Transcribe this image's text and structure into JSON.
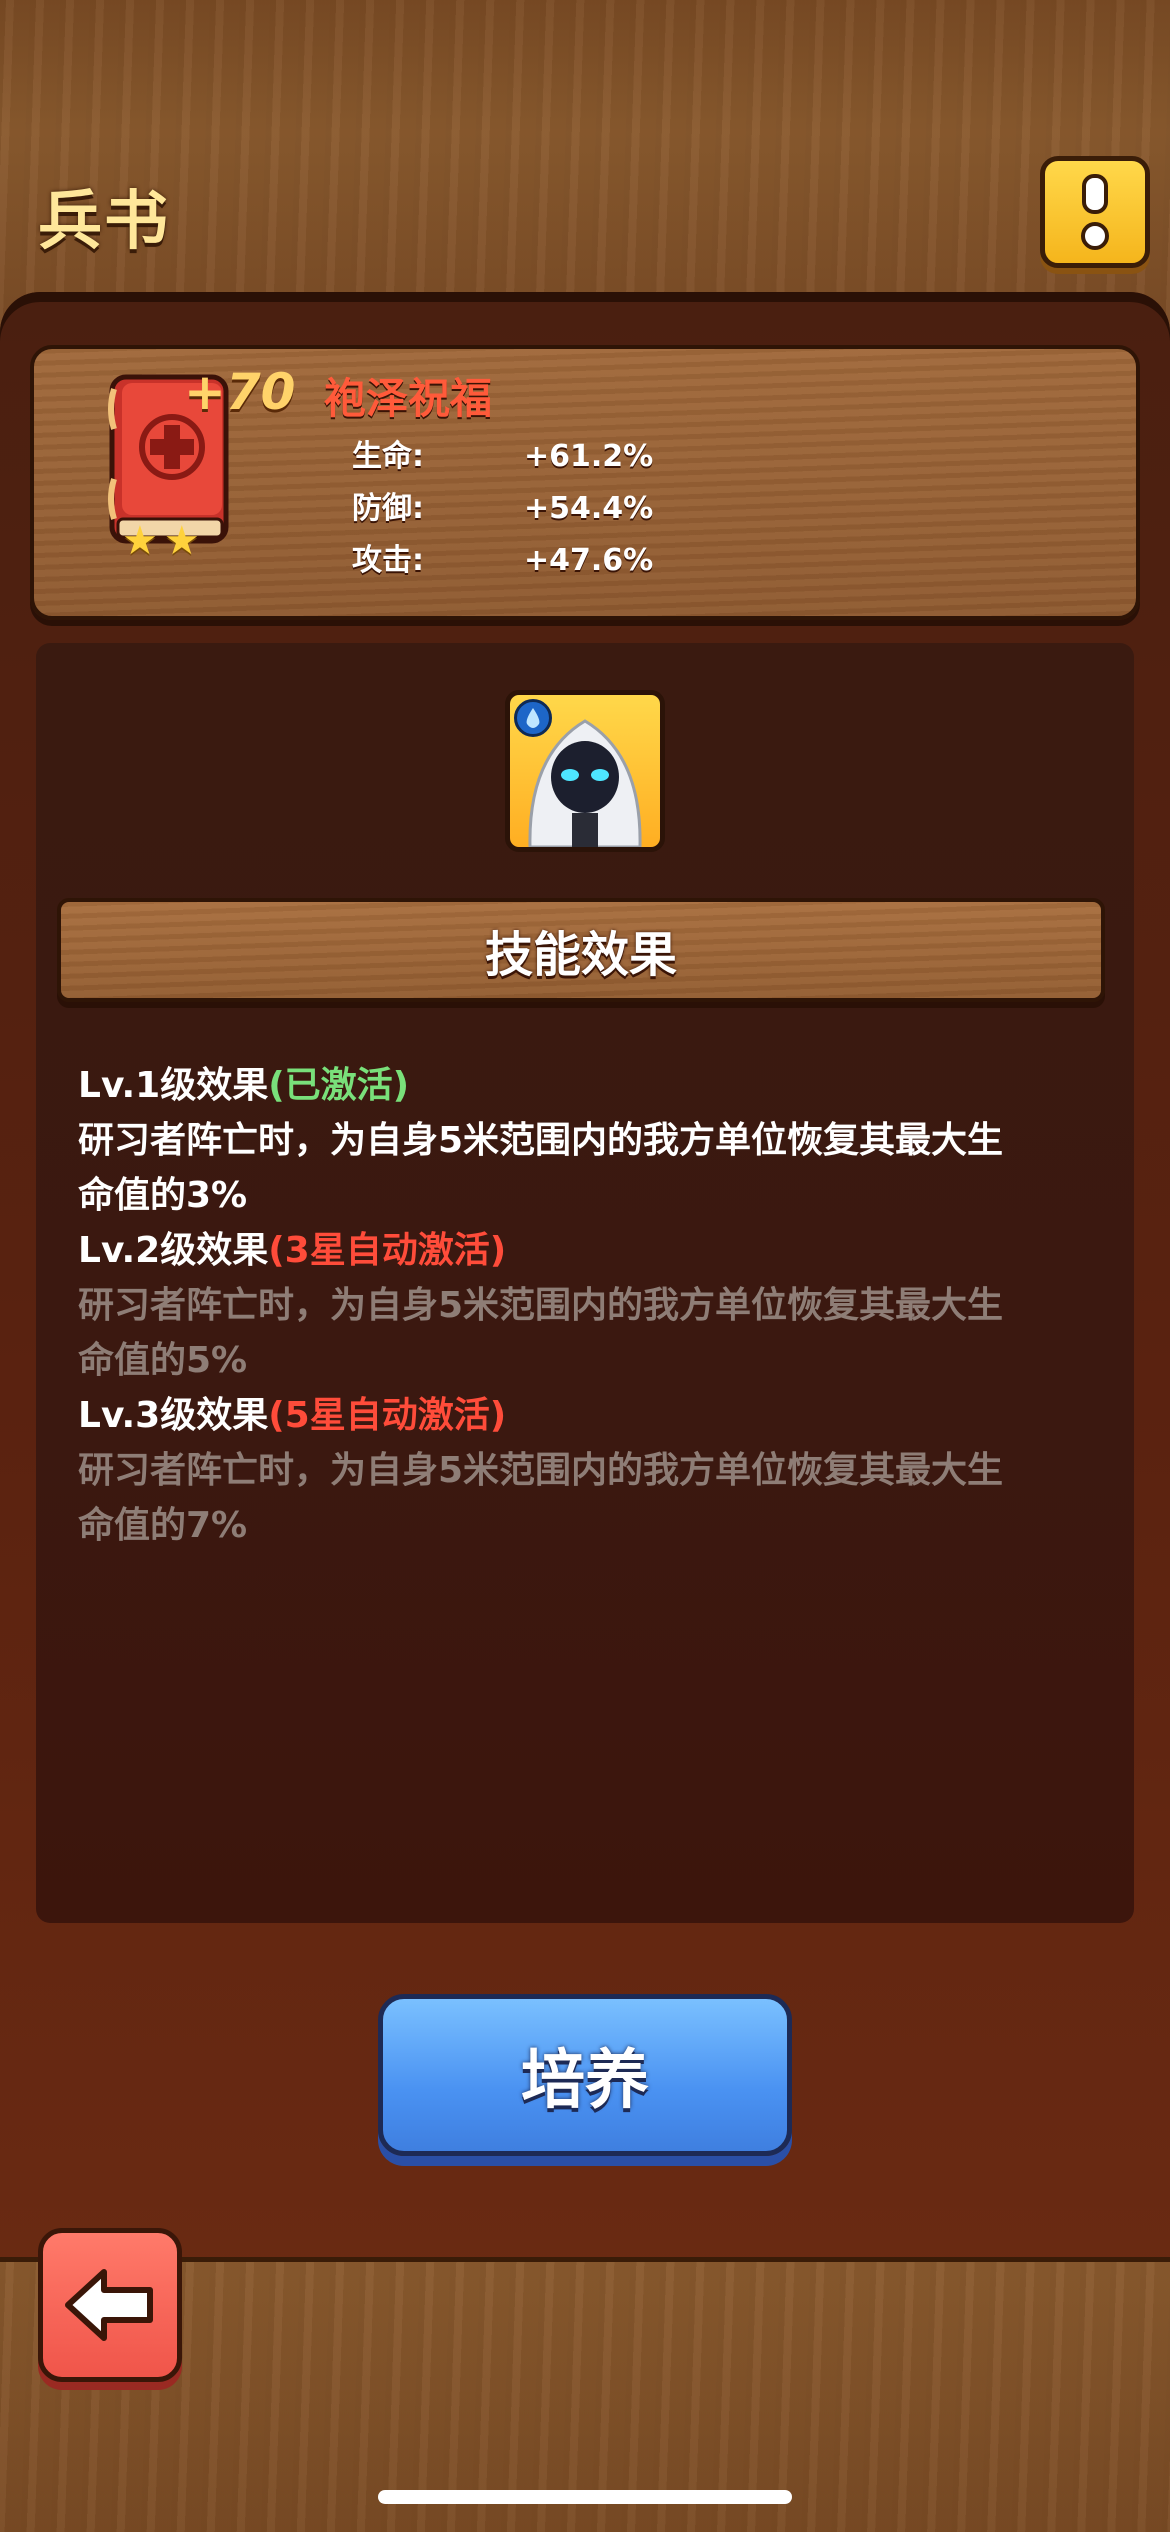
{
  "header": {
    "title": "兵书"
  },
  "info_button": {
    "icon": "exclamation-icon"
  },
  "book": {
    "level": "+70",
    "name": "袍泽祝福",
    "stars": 2,
    "stats": [
      {
        "label": "生命:",
        "value": "+61.2%"
      },
      {
        "label": "防御:",
        "value": "+54.4%"
      },
      {
        "label": "攻击:",
        "value": "+47.6%"
      }
    ]
  },
  "hero": {
    "icon": "hooded-hero-icon",
    "element_icon": "water-drop-icon"
  },
  "skill": {
    "section_title": "技能效果",
    "levels": [
      {
        "title": "Lv.1级效果",
        "status": "(已激活)",
        "status_color": "#79e07a",
        "desc_line1": "研习者阵亡时，为自身5米范围内的我方单位恢复其最大生",
        "desc_line2": "命值的3%",
        "active": true
      },
      {
        "title": "Lv.2级效果",
        "status": "(3星自动激活)",
        "status_color": "#ff4c3a",
        "desc_line1": "研习者阵亡时，为自身5米范围内的我方单位恢复其最大生",
        "desc_line2": "命值的5%",
        "active": false
      },
      {
        "title": "Lv.3级效果",
        "status": "(5星自动激活)",
        "status_color": "#ff4c3a",
        "desc_line1": "研习者阵亡时，为自身5米范围内的我方单位恢复其最大生",
        "desc_line2": "命值的7%",
        "active": false
      }
    ]
  },
  "actions": {
    "train_label": "培养",
    "back_icon": "back-arrow-icon"
  },
  "colors": {
    "accent_gold": "#ffe79a",
    "name_red": "#ff5a3a",
    "button_blue": "#4a92f2",
    "back_red": "#f0554a"
  }
}
